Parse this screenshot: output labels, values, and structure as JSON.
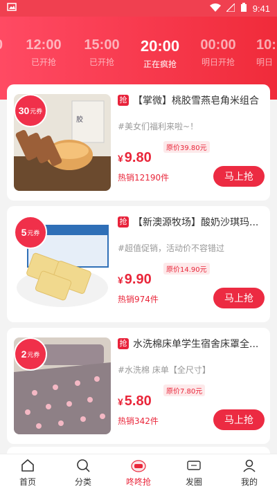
{
  "status_bar": {
    "time": "9:41"
  },
  "time_tabs": [
    {
      "time": "0",
      "status": ""
    },
    {
      "time": "12:00",
      "status": "已开抢"
    },
    {
      "time": "15:00",
      "status": "已开抢"
    },
    {
      "time": "20:00",
      "status": "正在疯抢"
    },
    {
      "time": "00:00",
      "status": "明日开抢"
    },
    {
      "time": "10:",
      "status": "明日"
    }
  ],
  "products": [
    {
      "coupon_amount": "30",
      "coupon_unit": "元券",
      "badge": "抢",
      "title": "【掌微】桃胶雪燕皂角米组合",
      "tag": "#美女们福利来啦~！",
      "price": "9.80",
      "currency": "¥",
      "original_price": "原价39.80元",
      "sold": "热销12190件",
      "buy_label": "马上抢"
    },
    {
      "coupon_amount": "5",
      "coupon_unit": "元券",
      "badge": "抢",
      "title": "【新澳源牧场】酸奶沙琪玛...",
      "tag": "#超值促销，活动价不容错过",
      "price": "9.90",
      "currency": "¥",
      "original_price": "原价14.90元",
      "sold": "热销974件",
      "buy_label": "马上抢"
    },
    {
      "coupon_amount": "2",
      "coupon_unit": "元券",
      "badge": "抢",
      "title": "水洗棉床单学生宿舍床罩全...",
      "tag": "#水洗棉 床单【全尺寸】",
      "price": "5.80",
      "currency": "¥",
      "original_price": "原价7.80元",
      "sold": "热销342件",
      "buy_label": "马上抢"
    }
  ],
  "tabbar": {
    "home": "首页",
    "category": "分类",
    "dongdong": "咚咚抢",
    "circle": "发圈",
    "mine": "我的"
  },
  "colors": {
    "brand_red": "#e9263a",
    "header_start": "#ff4a63",
    "header_end": "#f02b3a"
  }
}
